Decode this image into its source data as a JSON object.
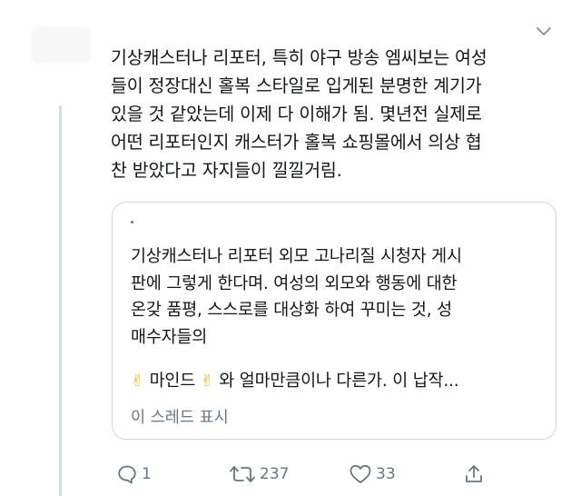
{
  "tweet": {
    "text": "기상캐스터나 리포터, 특히 야구 방송 엠씨보는 여성\n들이 정장대신 홀복 스타일로 입게된 분명한 계기가\n있을 것 같았는데 이제 다 이해가 됨. 몇년전 실제로\n어떤 리포터인지 캐스터가 홀복 쇼핑몰에서 의상 협\n찬 받았다고 자지들이 낄낄거림."
  },
  "quote": {
    "text": "기상캐스터나 리포터 외모 고나리질 시청자 게시\n판에 그렇게 한다며. 여성의 외모와 행동에 대한\n온갖 품평, 스스로를 대상화 하여 꾸미는 것, 성\n매수자들의",
    "emoji": "✌",
    "word_mind": " 마인드 ",
    "rest": " 와 얼마만큼이나 다른가. 이 납작...",
    "show_thread": "이 스레드 표시"
  },
  "actions": {
    "reply_count": "1",
    "retweet_count": "237",
    "like_count": "33"
  },
  "icons": {
    "caret": "chevron-down-icon",
    "reply": "reply-icon",
    "retweet": "retweet-icon",
    "like": "heart-icon",
    "share": "share-icon"
  },
  "colors": {
    "text": "#14171a",
    "secondary": "#657786",
    "border": "#ccd6dd",
    "thread_line": "#d5dce1"
  }
}
